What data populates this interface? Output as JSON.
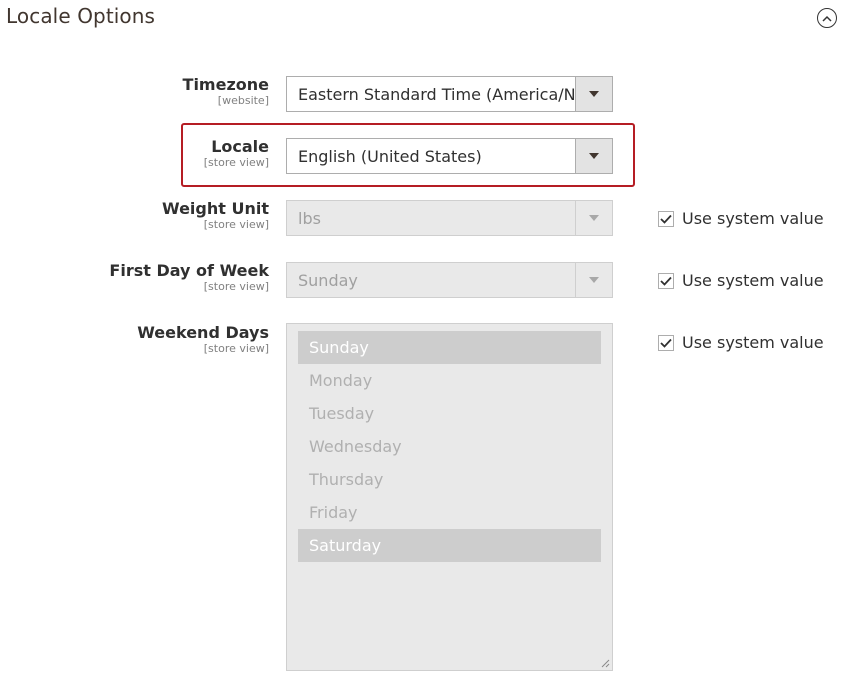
{
  "section": {
    "title": "Locale Options"
  },
  "fields": {
    "timezone": {
      "label": "Timezone",
      "scope": "[website]",
      "value": "Eastern Standard Time (America/New_York)"
    },
    "locale": {
      "label": "Locale",
      "scope": "[store view]",
      "value": "English (United States)"
    },
    "weight_unit": {
      "label": "Weight Unit",
      "scope": "[store view]",
      "value": "lbs",
      "system_value_label": "Use system value"
    },
    "first_day": {
      "label": "First Day of Week",
      "scope": "[store view]",
      "value": "Sunday",
      "system_value_label": "Use system value"
    },
    "weekend_days": {
      "label": "Weekend Days",
      "scope": "[store view]",
      "system_value_label": "Use system value",
      "options": [
        {
          "label": "Sunday",
          "selected": true
        },
        {
          "label": "Monday",
          "selected": false
        },
        {
          "label": "Tuesday",
          "selected": false
        },
        {
          "label": "Wednesday",
          "selected": false
        },
        {
          "label": "Thursday",
          "selected": false
        },
        {
          "label": "Friday",
          "selected": false
        },
        {
          "label": "Saturday",
          "selected": true
        }
      ]
    }
  },
  "colors": {
    "highlight": "#b51d24",
    "selected_option": "#cdcdcd"
  }
}
